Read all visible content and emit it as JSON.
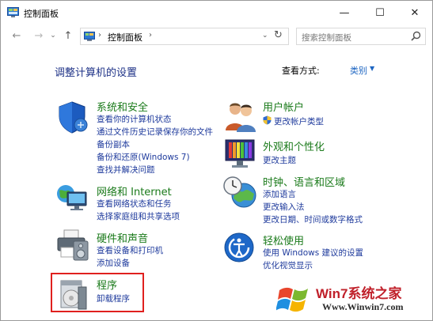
{
  "window": {
    "title": "控制面板"
  },
  "controls": {
    "minimize": "—",
    "maximize": "☐",
    "close": "✕"
  },
  "nav": {
    "back": "←",
    "forward": "→",
    "recent": "⌄",
    "up": "↑",
    "refresh": "↻",
    "dropdown": "⌄"
  },
  "address": {
    "separator": "›",
    "location": "控制面板"
  },
  "search": {
    "placeholder": "搜索控制面板"
  },
  "page": {
    "heading": "调整计算机的设置",
    "view_by_label": "查看方式:",
    "view_by_value": "类别",
    "view_by_arrow": "▼"
  },
  "categories": [
    {
      "title": "系统和安全",
      "icon": "shield-icon",
      "links": [
        "查看你的计算机状态",
        "通过文件历史记录保存你的文件",
        "备份副本",
        "备份和还原(Windows 7)",
        "查找并解决问题"
      ]
    },
    {
      "title": "网络和 Internet",
      "icon": "network-icon",
      "links": [
        "查看网络状态和任务",
        "选择家庭组和共享选项"
      ]
    },
    {
      "title": "硬件和声音",
      "icon": "printer-icon",
      "links": [
        "查看设备和打印机",
        "添加设备"
      ]
    },
    {
      "title": "程序",
      "icon": "programs-icon",
      "links": [
        "卸载程序"
      ]
    },
    {
      "title": "用户帐户",
      "icon": "users-icon",
      "links": [
        "更改帐户类型"
      ]
    },
    {
      "title": "外观和个性化",
      "icon": "appearance-icon",
      "links": [
        "更改主题"
      ]
    },
    {
      "title": "时钟、语言和区域",
      "icon": "clock-globe-icon",
      "links": [
        "添加语言",
        "更改输入法",
        "更改日期、时间或数字格式"
      ]
    },
    {
      "title": "轻松使用",
      "icon": "accessibility-icon",
      "links": [
        "使用 Windows 建议的设置",
        "优化视觉显示"
      ]
    }
  ],
  "watermark": {
    "title": "Win7系统之家",
    "url": "Www.Winwin7.com"
  },
  "colors": {
    "heading": "#1e3287",
    "category": "#1a7a1a",
    "link": "#1e3a9c",
    "highlight": "#e0201e"
  }
}
